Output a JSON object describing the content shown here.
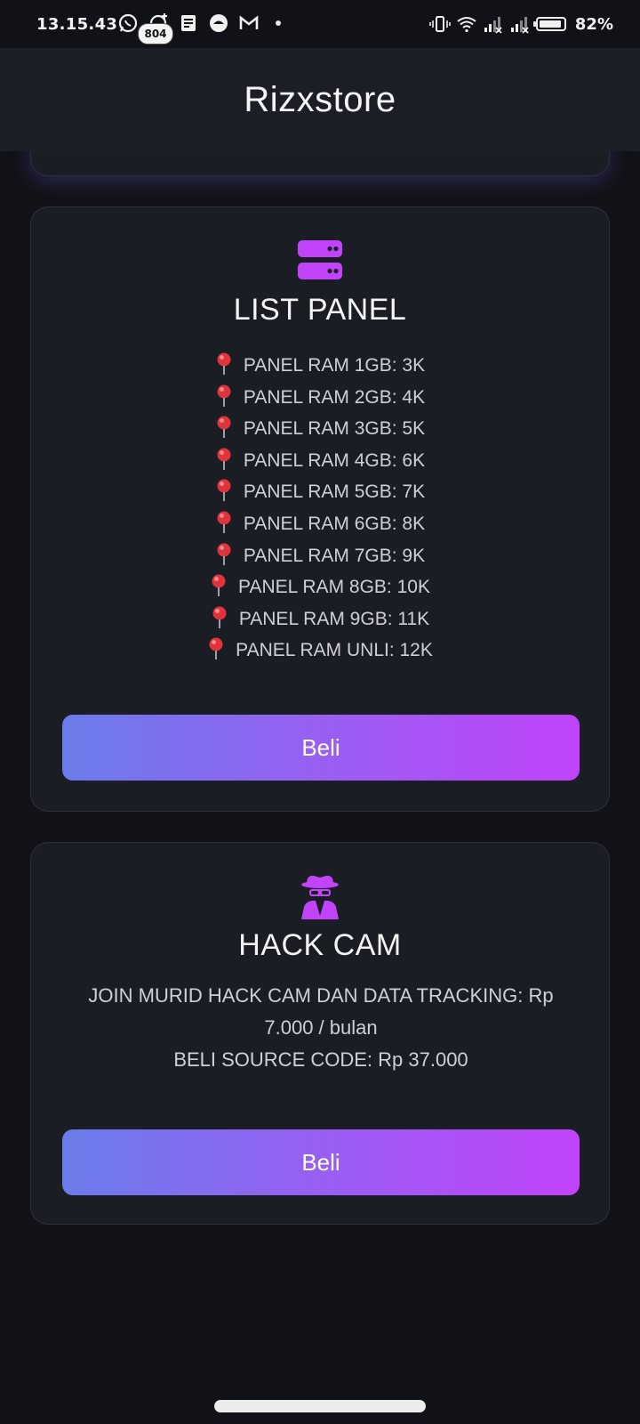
{
  "status_bar": {
    "time": "13.15.43",
    "notification_badge": "804",
    "battery": "82%",
    "left_icons": [
      "whatsapp-icon",
      "threads-icon",
      "notes-icon",
      "app-icon",
      "gmail-icon"
    ],
    "right_icons": [
      "vibrate-icon",
      "wifi-icon",
      "signal-icon",
      "signal-icon",
      "battery-icon"
    ]
  },
  "header": {
    "title": "Rizxstore"
  },
  "cards": [
    {
      "icon": "server-icon",
      "title": "LIST PANEL",
      "items": [
        "PANEL RAM 1GB: 3K",
        "PANEL RAM 2GB: 4K",
        "PANEL RAM 3GB: 5K",
        "PANEL RAM 4GB: 6K",
        "PANEL RAM 5GB: 7K",
        "PANEL RAM 6GB: 8K",
        "PANEL RAM 7GB: 9K",
        "PANEL RAM 8GB: 10K",
        "PANEL RAM 9GB: 11K",
        "PANEL RAM UNLI: 12K"
      ],
      "button_label": "Beli"
    },
    {
      "icon": "spy-icon",
      "title": "HACK CAM",
      "lines": [
        "JOIN MURID HACK CAM DAN DATA TRACKING: Rp 7.000 / bulan",
        "BELI SOURCE CODE: Rp 37.000"
      ],
      "button_label": "Beli"
    }
  ],
  "colors": {
    "background": "#111217",
    "header_bg": "#1c1e27",
    "card_bg": "#1b1d25",
    "accent_purple": "#c144fb",
    "accent_blue": "#6b7cea"
  }
}
